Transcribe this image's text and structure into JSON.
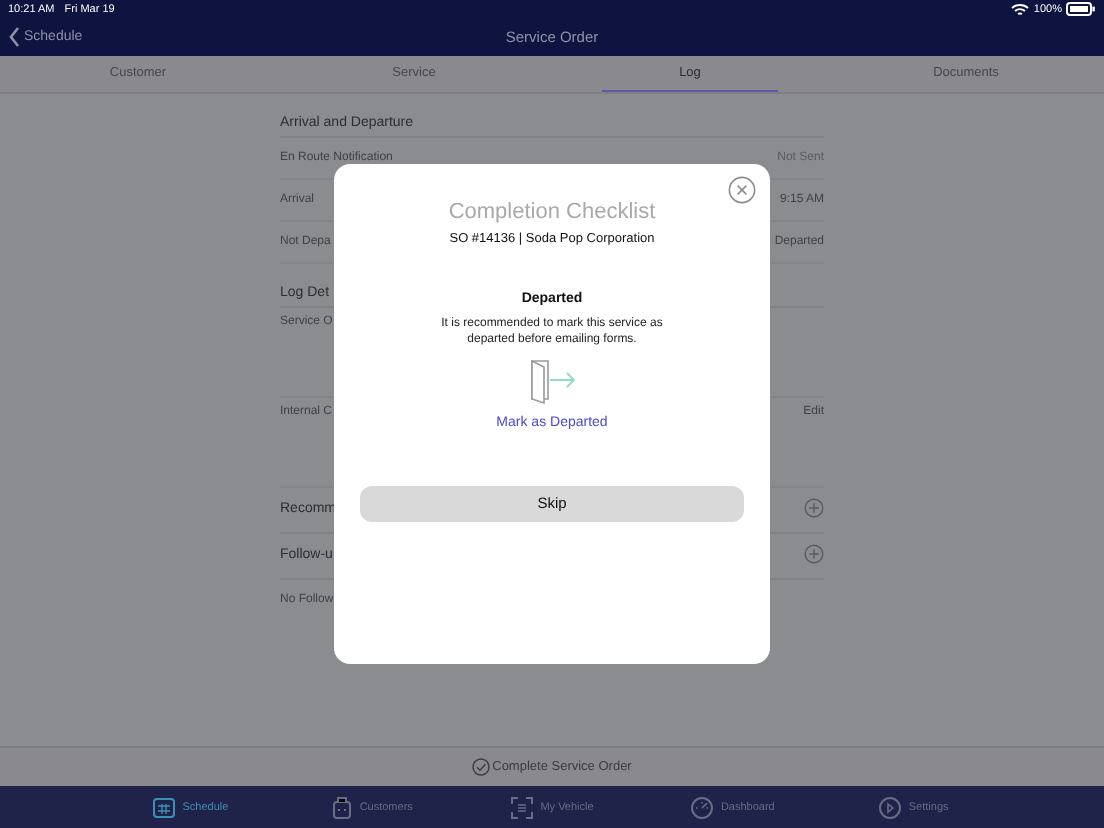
{
  "status_bar": {
    "time": "10:21 AM",
    "date": "Fri Mar 19",
    "battery": "100%"
  },
  "nav": {
    "back": "Schedule",
    "title": "Service Order"
  },
  "tabs": [
    {
      "label": "Customer",
      "selected": false
    },
    {
      "label": "Service",
      "selected": false
    },
    {
      "label": "Log",
      "selected": true
    },
    {
      "label": "Documents",
      "selected": false
    }
  ],
  "sections": [
    {
      "title": "Arrival and Departure",
      "can_add": false,
      "rows": [
        {
          "kind": "line",
          "label": "En Route Notification",
          "value": "Not Sent",
          "muted": true
        },
        {
          "kind": "line",
          "label": "Arrival",
          "value": "9:15 AM",
          "muted": false
        },
        {
          "kind": "line",
          "label": "Not Depa",
          "value": "Departed",
          "muted": false
        }
      ]
    },
    {
      "title": "Log Det",
      "can_add": false,
      "rows": [
        {
          "kind": "note",
          "label": "Service O"
        },
        {
          "kind": "note",
          "label": "Internal C",
          "value": "Edit",
          "muted": false
        }
      ]
    },
    {
      "title": "Recomm",
      "can_add": true
    },
    {
      "title": "Follow-u",
      "can_add": true,
      "rows": [
        {
          "kind": "line",
          "label": "No Follow"
        }
      ]
    }
  ],
  "complete_button": "Complete Service Order",
  "tab_bar": [
    {
      "label": "Schedule",
      "selected": true
    },
    {
      "label": "Customers",
      "selected": false
    },
    {
      "label": "My Vehicle",
      "selected": false
    },
    {
      "label": "Dashboard",
      "selected": false
    },
    {
      "label": "Settings",
      "selected": false
    }
  ],
  "modal": {
    "title": "Completion Checklist",
    "subtitle": "SO #14136 | Soda Pop Corporation",
    "step_title": "Departed",
    "message": "It is recommended to mark this service as departed before emailing forms.",
    "action": "Mark as Departed",
    "skip": "Skip"
  }
}
